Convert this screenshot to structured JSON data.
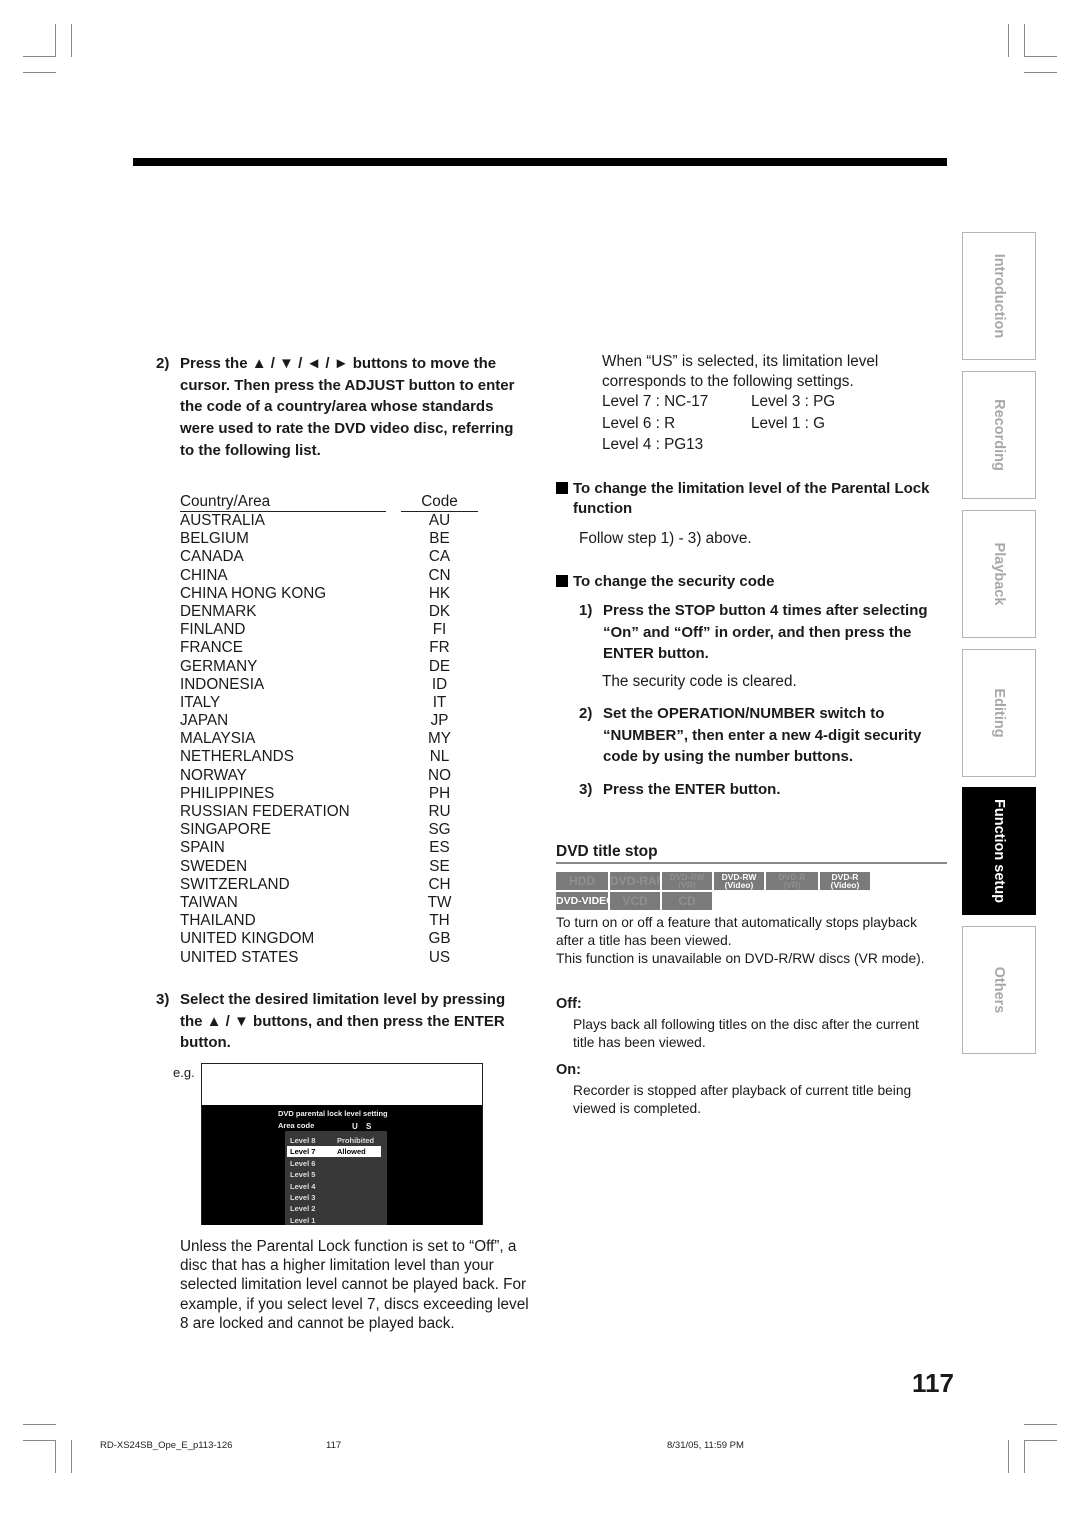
{
  "left": {
    "step2": {
      "num": "2)",
      "text": "Press the ▲ / ▼ / ◄ / ► buttons to move the cursor. Then press the ADJUST button to enter the code of a country/area whose standards were used to rate the DVD video disc, referring to the following list."
    },
    "country_table": {
      "headers": [
        "Country/Area",
        "Code"
      ],
      "rows": [
        {
          "name": "AUSTRALIA",
          "code": "AU"
        },
        {
          "name": "BELGIUM",
          "code": "BE"
        },
        {
          "name": "CANADA",
          "code": "CA"
        },
        {
          "name": "CHINA",
          "code": "CN"
        },
        {
          "name": "CHINA HONG KONG",
          "code": "HK"
        },
        {
          "name": "DENMARK",
          "code": "DK"
        },
        {
          "name": "FINLAND",
          "code": "FI"
        },
        {
          "name": "FRANCE",
          "code": "FR"
        },
        {
          "name": "GERMANY",
          "code": "DE"
        },
        {
          "name": "INDONESIA",
          "code": "ID"
        },
        {
          "name": "ITALY",
          "code": "IT"
        },
        {
          "name": "JAPAN",
          "code": "JP"
        },
        {
          "name": "MALAYSIA",
          "code": "MY"
        },
        {
          "name": "NETHERLANDS",
          "code": "NL"
        },
        {
          "name": "NORWAY",
          "code": "NO"
        },
        {
          "name": "PHILIPPINES",
          "code": "PH"
        },
        {
          "name": "RUSSIAN FEDERATION",
          "code": "RU"
        },
        {
          "name": "SINGAPORE",
          "code": "SG"
        },
        {
          "name": "SPAIN",
          "code": "ES"
        },
        {
          "name": "SWEDEN",
          "code": "SE"
        },
        {
          "name": "SWITZERLAND",
          "code": "CH"
        },
        {
          "name": "TAIWAN",
          "code": "TW"
        },
        {
          "name": "THAILAND",
          "code": "TH"
        },
        {
          "name": "UNITED KINGDOM",
          "code": "GB"
        },
        {
          "name": "UNITED STATES",
          "code": "US"
        }
      ]
    },
    "step3": {
      "num": "3)",
      "text": "Select the desired limitation level by pressing the ▲ / ▼ buttons, and then press the ENTER button."
    },
    "example": {
      "label": "e.g.",
      "screen_title": "DVD parental lock level setting",
      "area_label": "Area code",
      "area_value": "U S",
      "levels": [
        {
          "name": "Level 8",
          "status": "Prohibited",
          "selected": false
        },
        {
          "name": "Level 7",
          "status": "Allowed",
          "selected": true
        },
        {
          "name": "Level 6",
          "status": "",
          "selected": false
        },
        {
          "name": "Level 5",
          "status": "",
          "selected": false
        },
        {
          "name": "Level 4",
          "status": "",
          "selected": false
        },
        {
          "name": "Level 3",
          "status": "",
          "selected": false
        },
        {
          "name": "Level 2",
          "status": "",
          "selected": false
        },
        {
          "name": "Level 1",
          "status": "",
          "selected": false
        }
      ]
    },
    "note": "Unless the Parental Lock function is set to “Off”, a disc that has a higher limitation level than your selected limitation level cannot be played back. For example, if you select level 7, discs exceeding  level 8 are locked and cannot be played back."
  },
  "right": {
    "us_intro": "When “US” is selected, its limitation level corresponds to the following settings.",
    "us_levels": [
      [
        "Level 7 : NC-17",
        "Level 3 : PG"
      ],
      [
        "Level 6 : R",
        "Level 1 : G"
      ],
      [
        "Level 4 : PG13",
        ""
      ]
    ],
    "change_level": {
      "heading": "To change the limitation level of the Parental Lock function",
      "body": "Follow step 1) - 3) above."
    },
    "change_code": {
      "heading": "To change the security code",
      "steps": [
        {
          "num": "1)",
          "text": "Press the STOP button 4 times after selecting “On” and “Off” in order, and then press the ENTER button.",
          "note": "The security code is cleared."
        },
        {
          "num": "2)",
          "text": "Set the OPERATION/NUMBER switch to “NUMBER”, then enter a new 4-digit security code by using the number buttons.",
          "note": ""
        },
        {
          "num": "3)",
          "text": "Press the ENTER button.",
          "note": ""
        }
      ]
    },
    "dvd_title_stop": {
      "heading": "DVD title stop",
      "badges": [
        {
          "line1": "HDD",
          "line2": "",
          "active": false
        },
        {
          "line1": "DVD-RAM",
          "line2": "",
          "active": false
        },
        {
          "line1": "DVD-RW",
          "line2": "(VR)",
          "active": false
        },
        {
          "line1": "DVD-RW",
          "line2": "(Video)",
          "active": true
        },
        {
          "line1": "DVD-R",
          "line2": "(VR)",
          "active": false
        },
        {
          "line1": "DVD-R",
          "line2": "(Video)",
          "active": true
        },
        {
          "line1": "DVD-VIDEO",
          "line2": "",
          "active": true
        },
        {
          "line1": "VCD",
          "line2": "",
          "active": false
        },
        {
          "line1": "CD",
          "line2": "",
          "active": false
        }
      ],
      "description": "To turn on or off a feature that automatically stops playback after a title has been viewed.",
      "unavailable": "This function is unavailable on DVD-R/RW discs (VR mode).",
      "options": [
        {
          "label": "Off:",
          "text": "Plays back all following titles on the disc after the current title has been viewed."
        },
        {
          "label": "On:",
          "text": "Recorder is stopped after playback of current title being viewed is completed."
        }
      ]
    }
  },
  "side_tabs": [
    {
      "label": "Introduction",
      "active": false
    },
    {
      "label": "Recording",
      "active": false
    },
    {
      "label": "Playback",
      "active": false
    },
    {
      "label": "Editing",
      "active": false
    },
    {
      "label": "Function setup",
      "active": true
    },
    {
      "label": "Others",
      "active": false
    }
  ],
  "page_number": "117",
  "footer": {
    "file": "RD-XS24SB_Ope_E_p113-126",
    "page": "117",
    "timestamp": "8/31/05, 11:59 PM"
  }
}
